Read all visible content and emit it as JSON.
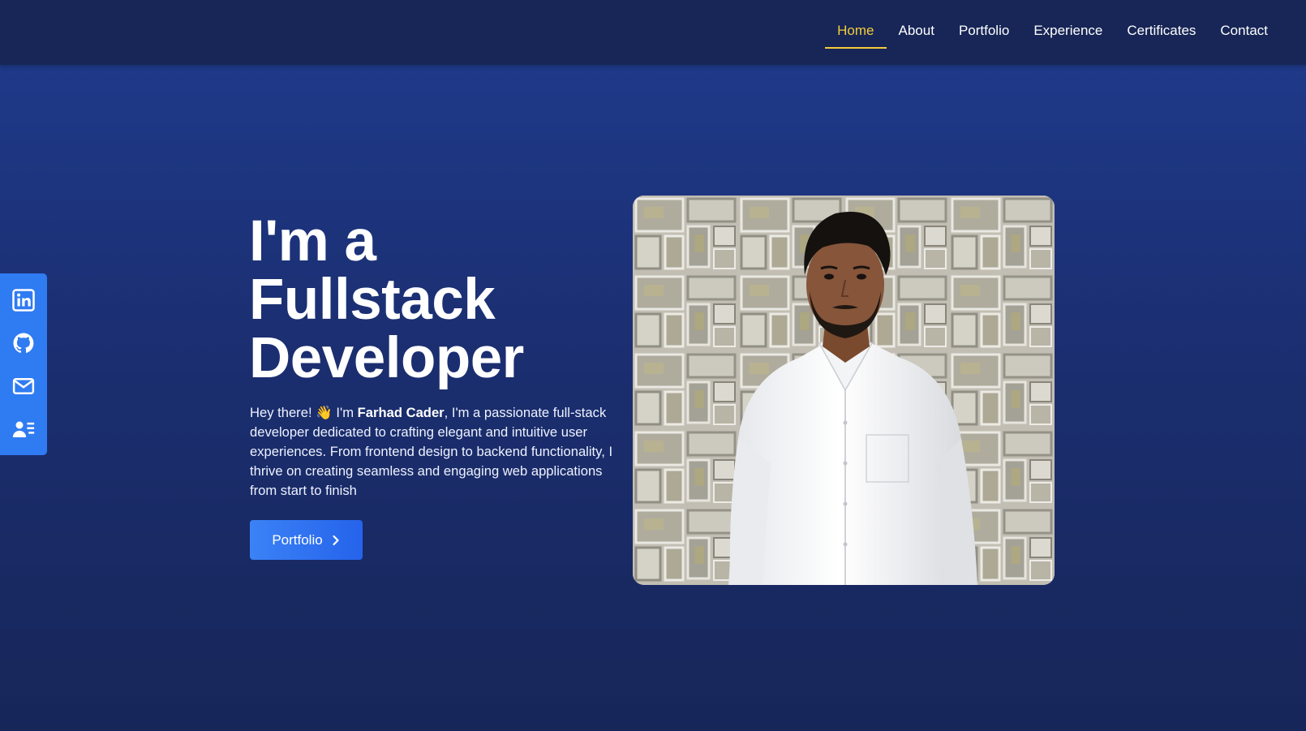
{
  "nav": {
    "items": [
      {
        "label": "Home",
        "active": true
      },
      {
        "label": "About",
        "active": false
      },
      {
        "label": "Portfolio",
        "active": false
      },
      {
        "label": "Experience",
        "active": false
      },
      {
        "label": "Certificates",
        "active": false
      },
      {
        "label": "Contact",
        "active": false
      }
    ]
  },
  "social": [
    {
      "icon": "linkedin-icon"
    },
    {
      "icon": "github-icon"
    },
    {
      "icon": "mail-icon"
    },
    {
      "icon": "contact-card-icon"
    }
  ],
  "hero": {
    "title_lines": [
      "I'm a",
      "Fullstack",
      "Developer"
    ],
    "desc_prefix": "Hey there! 👋 I'm ",
    "name": "Farhad Cader",
    "desc_suffix": ", I'm a passionate full-stack developer dedicated to crafting elegant and intuitive user experiences. From frontend design to backend functionality, I thrive on creating seamless and engaging web applications from start to finish",
    "button_label": "Portfolio"
  },
  "colors": {
    "accent": "#f4cc3c",
    "navbar_bg": "#172656",
    "social_bar_bg": "#2f7bf2",
    "button_bg": "#2f7bf2",
    "page_bg_top": "#1f3a8a",
    "page_bg_bottom": "#172659"
  }
}
